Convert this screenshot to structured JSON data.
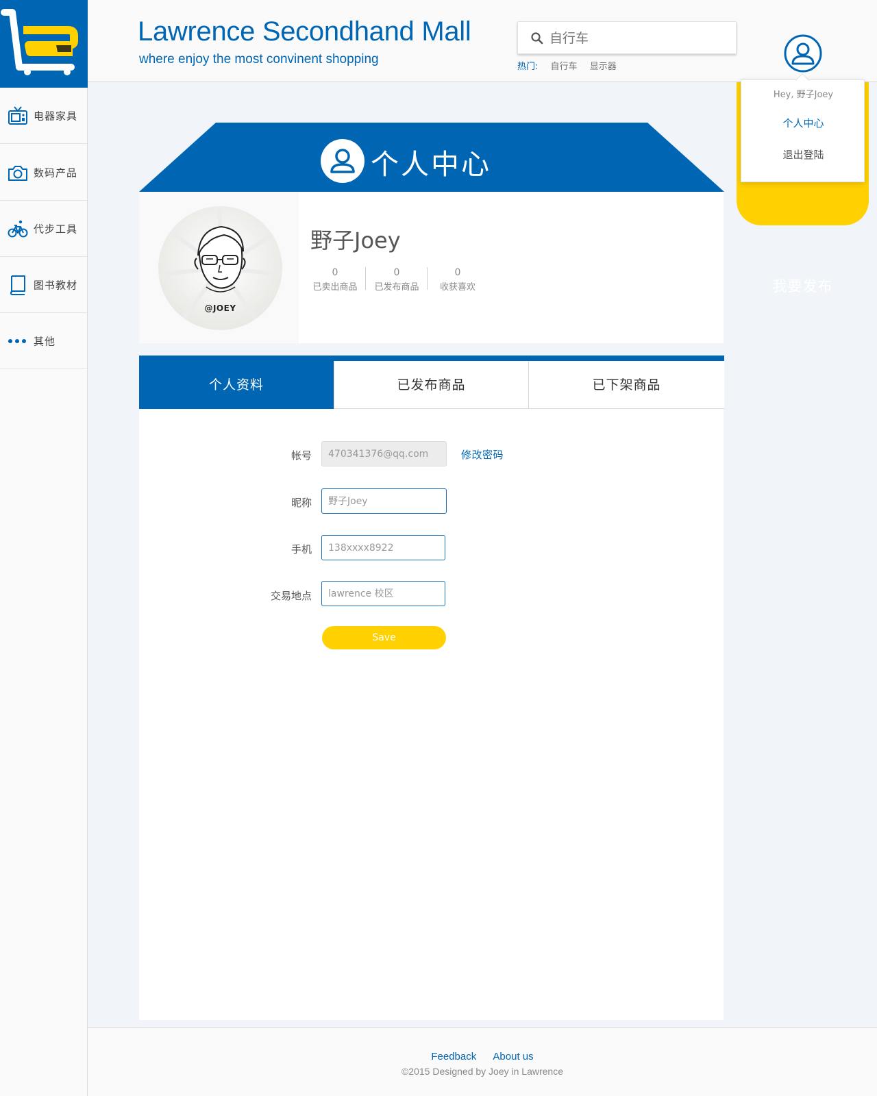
{
  "header": {
    "title": "Lawrence Secondhand Mall",
    "slogan": "where enjoy the most convinent shopping",
    "search": {
      "placeholder": "自行车"
    },
    "hot": {
      "label": "热门:",
      "items": [
        "自行车",
        "显示器"
      ]
    }
  },
  "sidebar": {
    "items": [
      {
        "label": "电器家具",
        "icon": "tv-icon"
      },
      {
        "label": "数码产品",
        "icon": "camera-icon"
      },
      {
        "label": "代步工具",
        "icon": "bicycle-icon"
      },
      {
        "label": "图书教材",
        "icon": "book-icon"
      },
      {
        "label": "其他",
        "icon": "more-dots-icon"
      }
    ]
  },
  "user_menu": {
    "greeting": "Hey, 野子Joey",
    "items": [
      "个人中心",
      "退出登陆"
    ]
  },
  "publish": {
    "label": "我要发布"
  },
  "banner": {
    "title": "个人中心"
  },
  "profile": {
    "avatar_caption": "@JOEY",
    "name": "野子Joey",
    "stats": [
      {
        "value": "0",
        "label": "已卖出商品"
      },
      {
        "value": "0",
        "label": "已发布商品"
      },
      {
        "value": "0",
        "label": "收获喜欢"
      }
    ]
  },
  "tabs": [
    "个人资料",
    "已发布商品",
    "已下架商品"
  ],
  "form": {
    "account": {
      "label": "帐号",
      "value": "470341376@qq.com"
    },
    "change_password": "修改密码",
    "nickname": {
      "label": "昵称",
      "placeholder": "野子Joey"
    },
    "phone": {
      "label": "手机",
      "placeholder": "138xxxx8922"
    },
    "location": {
      "label": "交易地点",
      "placeholder": "lawrence 校区"
    },
    "save": "Save"
  },
  "footer": {
    "links": [
      "Feedback",
      "About us"
    ],
    "copyright": "©2015  Designed by Joey in Lawrence"
  },
  "colors": {
    "primary": "#0066b3",
    "accent": "#ffd100",
    "background": "#f1f5f9"
  }
}
